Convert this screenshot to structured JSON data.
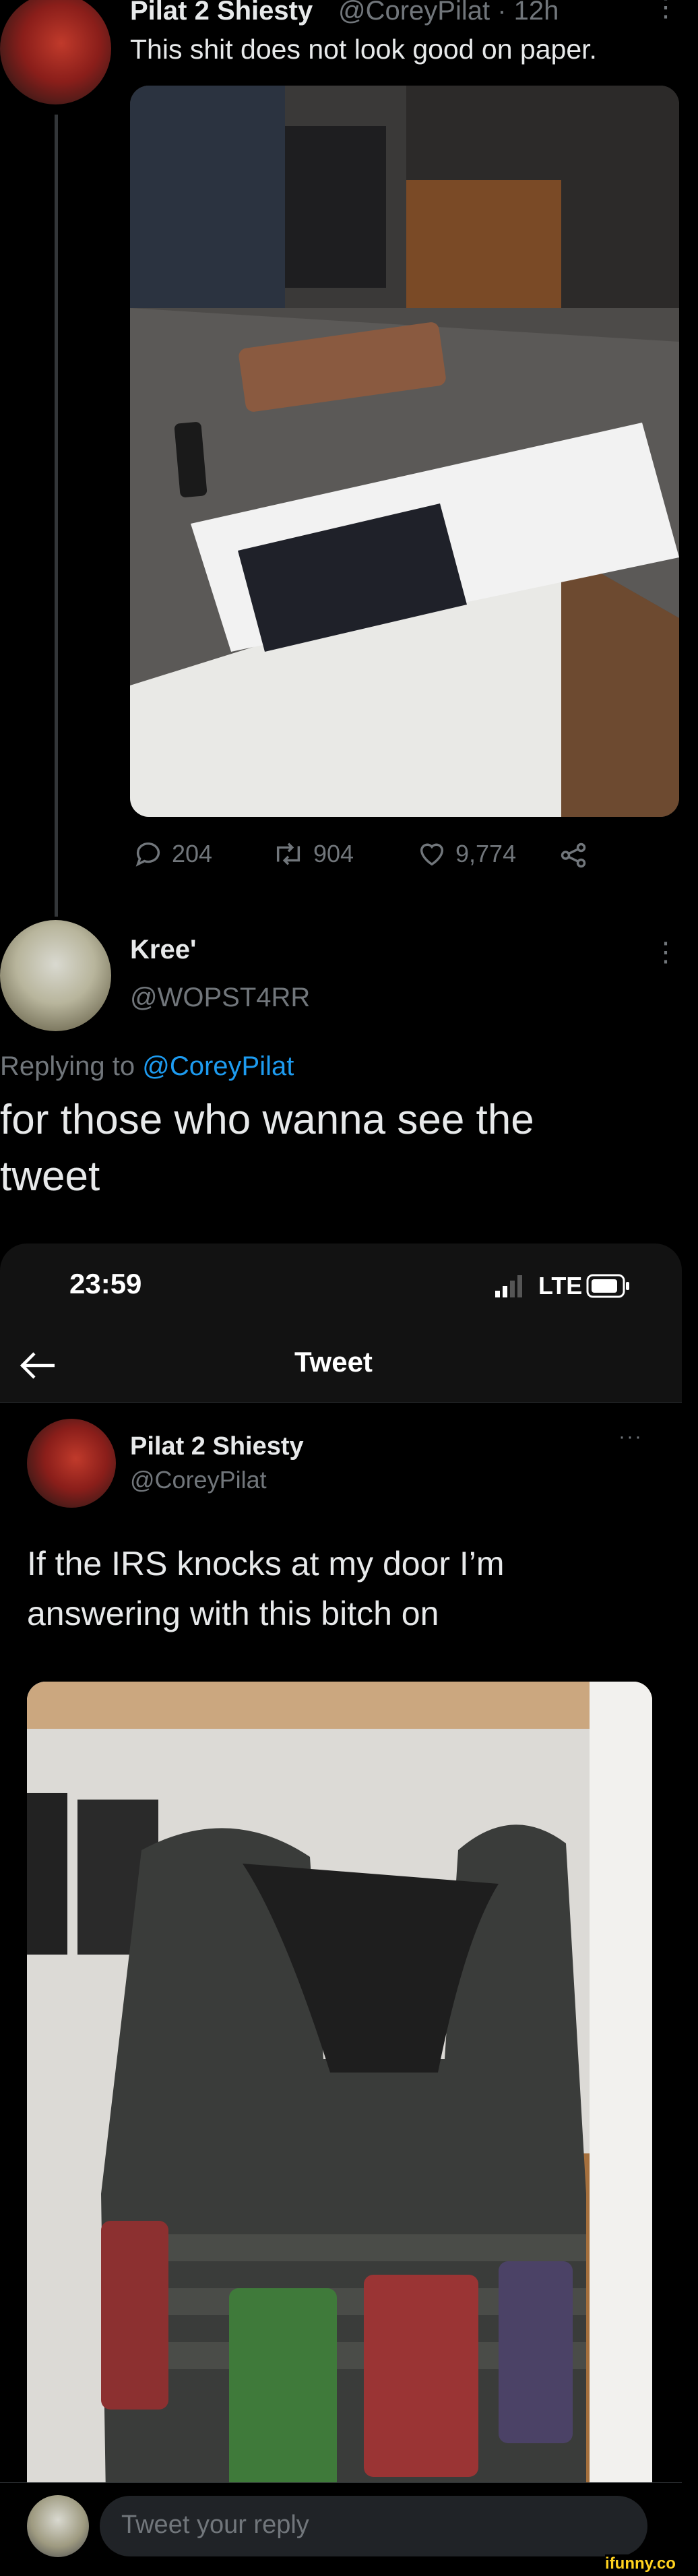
{
  "tweet1": {
    "author_name": "Pilat 2 Shiesty",
    "handle_time": "@CoreyPilat · 12h",
    "text": "This shit does not look good on paper.",
    "actions": {
      "replies": "204",
      "retweets": "904",
      "likes": "9,774"
    }
  },
  "reply": {
    "author_name": "Kree'",
    "handle": "@WOPST4RR",
    "replying_label": "Replying to",
    "replying_to": "@CoreyPilat",
    "text": "for those who wanna see the tweet"
  },
  "embedded_screenshot": {
    "status_time": "23:59",
    "network": "LTE",
    "header_title": "Tweet",
    "tweet": {
      "author_name": "Pilat 2 Shiesty",
      "handle": "@CoreyPilat",
      "text": "If the IRS knocks at my door I’m answering with this bitch on"
    },
    "reply_placeholder": "Tweet your reply"
  },
  "watermark": "ifunny.co",
  "icons": [
    "reply-icon",
    "retweet-icon",
    "like-icon",
    "share-icon",
    "more-icon",
    "back-arrow-icon",
    "battery-icon",
    "signal-icon"
  ]
}
